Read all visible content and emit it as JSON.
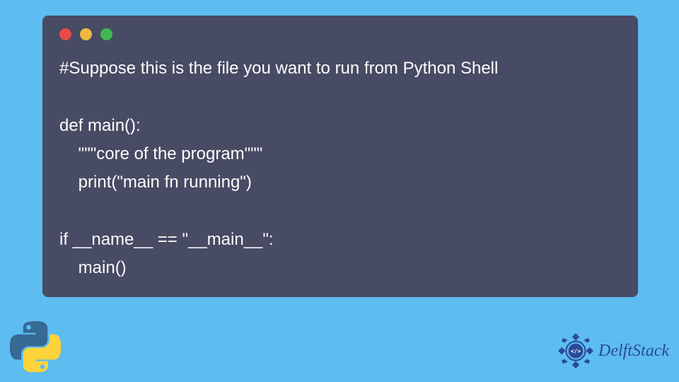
{
  "code": {
    "line1": "#Suppose this is the file you want to run from Python Shell",
    "line2": "",
    "line3": "def main():",
    "line4": "    \"\"\"core of the program\"\"\"",
    "line5": "    print(\"main fn running\")",
    "line6": "",
    "line7": "if __name__ == \"__main__\":",
    "line8": "    main()"
  },
  "logos": {
    "delft_label": "DelftStack"
  },
  "colors": {
    "bg": "#5dbcf0",
    "window": "#474b63",
    "text": "#fdfdfd",
    "delft_blue": "#2a4a9a",
    "python_blue": "#366994",
    "python_yellow": "#ffd43b"
  }
}
